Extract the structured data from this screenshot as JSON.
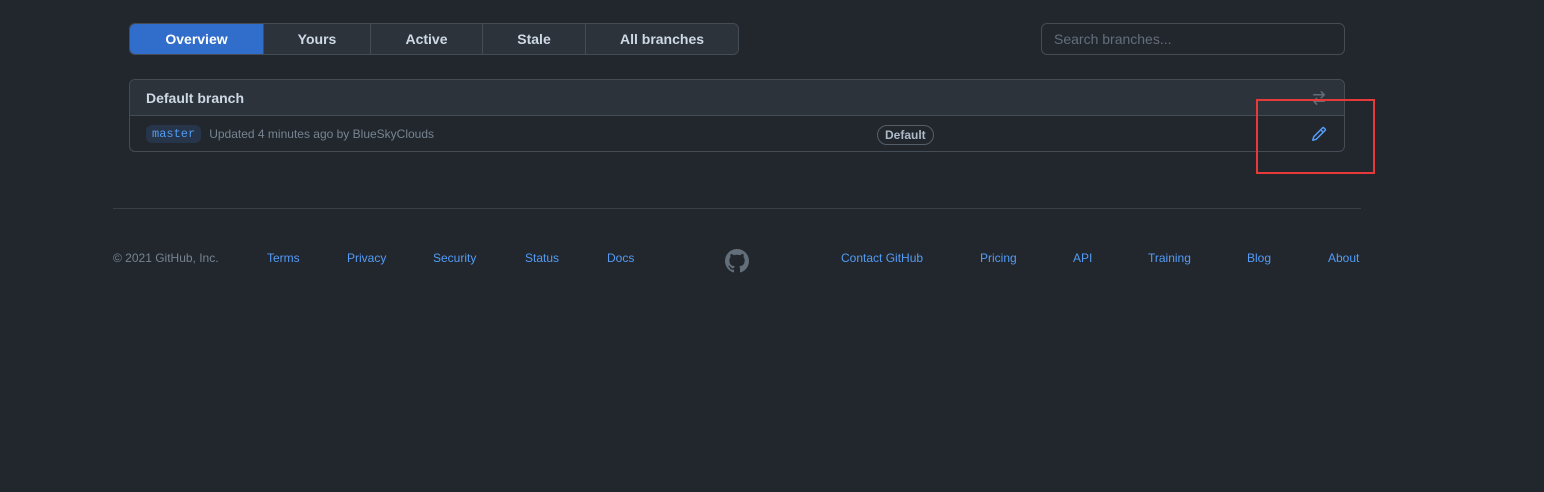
{
  "tabs": [
    {
      "label": "Overview",
      "selected": true
    },
    {
      "label": "Yours",
      "selected": false
    },
    {
      "label": "Active",
      "selected": false
    },
    {
      "label": "Stale",
      "selected": false
    },
    {
      "label": "All branches",
      "selected": false
    }
  ],
  "search": {
    "placeholder": "Search branches..."
  },
  "default_branch": {
    "title": "Default branch",
    "branch": "master",
    "updated": "Updated 4 minutes ago by BlueSkyClouds",
    "badge": "Default"
  },
  "footer": {
    "copyright": "© 2021 GitHub, Inc.",
    "left_links": [
      "Terms",
      "Privacy",
      "Security",
      "Status",
      "Docs"
    ],
    "right_links": [
      "Contact GitHub",
      "Pricing",
      "API",
      "Training",
      "Blog",
      "About"
    ]
  },
  "colors": {
    "background": "#22272e",
    "accent": "#316dca",
    "link": "#539bf5",
    "highlight": "#e5393a"
  },
  "icons": [
    "switch-arrows-icon",
    "pencil-icon",
    "github-mark-icon"
  ]
}
